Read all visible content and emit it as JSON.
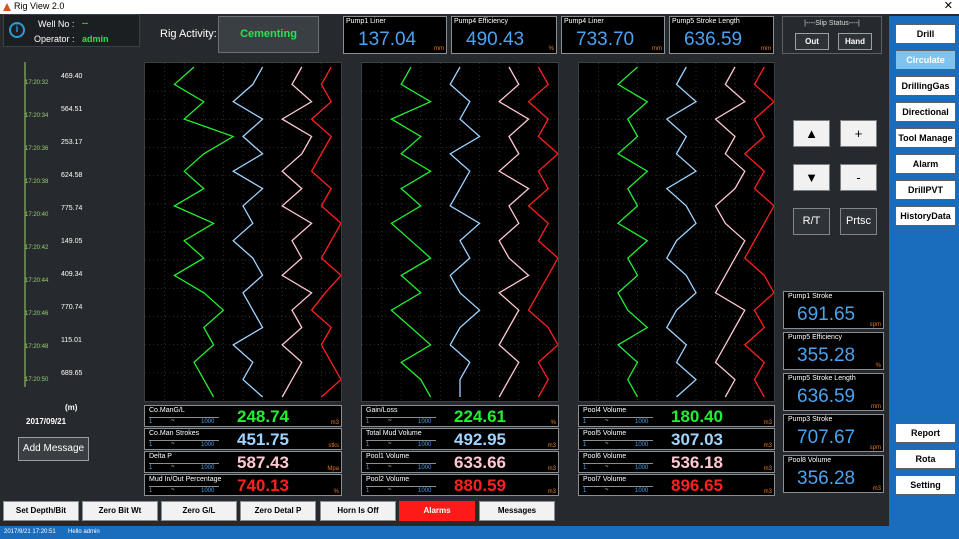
{
  "window": {
    "title": "Rig View 2.0",
    "close_glyph": "✕"
  },
  "user": {
    "well_label": "Well No :",
    "well_value": "--",
    "operator_label": "Operator :",
    "operator_value": "admin",
    "info_glyph": "i"
  },
  "rig_activity": {
    "label": "Rig Activity:",
    "value": "Cementing"
  },
  "top_pumps": [
    {
      "label": "Pump1 Liner",
      "value": "137.04",
      "unit": "mm"
    },
    {
      "label": "Pump4 Efficiency",
      "value": "490.43",
      "unit": "%"
    },
    {
      "label": "Pump4 Liner",
      "value": "733.70",
      "unit": "mm"
    },
    {
      "label": "Pump5 Stroke Length",
      "value": "636.59",
      "unit": "mm"
    }
  ],
  "slip": {
    "title": "|----Slip Status----|",
    "out": "Out",
    "hand": "Hand"
  },
  "nav": {
    "drill": "Drill",
    "circulate": "Circulate",
    "drillinggas": "DrillingGas",
    "directional": "Directional",
    "toolmanage": "Tool Manage",
    "alarm": "Alarm",
    "drillpvt": "DrillPVT",
    "historydata": "HistoryData",
    "report": "Report",
    "rota": "Rota",
    "setting": "Setting"
  },
  "controls": {
    "up": "▲",
    "plus": "+",
    "down": "▼",
    "minus": "-",
    "rt": "R/T",
    "prtsc": "Prtsc"
  },
  "right_panels": [
    {
      "label": "Pump1 Stroke",
      "value": "691.65",
      "unit": "spm"
    },
    {
      "label": "Pump5 Efficiency",
      "value": "355.28",
      "unit": "%"
    },
    {
      "label": "Pump5 Stroke Length",
      "value": "636.59",
      "unit": "mm"
    },
    {
      "label": "Pump3 Stroke",
      "value": "707.67",
      "unit": "spm"
    },
    {
      "label": "Pool8 Volume",
      "value": "356.28",
      "unit": "m3"
    }
  ],
  "depth": {
    "times": [
      "17:20:32",
      "17:20:34",
      "17:20:36",
      "17:20:38",
      "17:20:40",
      "17:20:42",
      "17:20:44",
      "17:20:46",
      "17:20:48",
      "17:20:50"
    ],
    "values": [
      "469.40",
      "564.51",
      "253.17",
      "624.58",
      "775.74",
      "149.05",
      "409.34",
      "770.74",
      "115.01",
      "689.65"
    ],
    "unit": "(m)",
    "date": "2017/09/21"
  },
  "add_message": "Add Message",
  "readouts": [
    [
      {
        "label": "Co.ManG/L",
        "min": "1",
        "max": "1000",
        "value": "248.74",
        "unit": "m3",
        "color": "#22ee33"
      },
      {
        "label": "Co.Man Strokes",
        "min": "1",
        "max": "1000",
        "value": "451.75",
        "unit": "stks",
        "color": "#9fd4ff"
      },
      {
        "label": "Delta P",
        "min": "1",
        "max": "1000",
        "value": "587.43",
        "unit": "Mpa",
        "color": "#ffc8d2"
      },
      {
        "label": "Mud In/Out Percentage",
        "min": "1",
        "max": "1000",
        "value": "740.13",
        "unit": "%",
        "color": "#ff2020"
      }
    ],
    [
      {
        "label": "Gain/Loss",
        "min": "1",
        "max": "1000",
        "value": "224.61",
        "unit": "%",
        "color": "#22ee33"
      },
      {
        "label": "Total Mud Volume",
        "min": "1",
        "max": "1000",
        "value": "492.95",
        "unit": "m3",
        "color": "#9fd4ff"
      },
      {
        "label": "Pool1 Volume",
        "min": "1",
        "max": "1000",
        "value": "633.66",
        "unit": "m3",
        "color": "#ffc8d2"
      },
      {
        "label": "Pool2 Volume",
        "min": "1",
        "max": "1000",
        "value": "880.59",
        "unit": "m3",
        "color": "#ff2020"
      }
    ],
    [
      {
        "label": "Pool4 Volume",
        "min": "1",
        "max": "1000",
        "value": "180.40",
        "unit": "m3",
        "color": "#22ee33"
      },
      {
        "label": "Pool5 Volume",
        "min": "1",
        "max": "1000",
        "value": "307.03",
        "unit": "m3",
        "color": "#9fd4ff"
      },
      {
        "label": "Pool6 Volume",
        "min": "1",
        "max": "1000",
        "value": "536.18",
        "unit": "m3",
        "color": "#ffc8d2"
      },
      {
        "label": "Pool7 Volume",
        "min": "1",
        "max": "1000",
        "value": "896.65",
        "unit": "m3",
        "color": "#ff2020"
      }
    ]
  ],
  "trends": [
    {
      "series": [
        [
          0.25,
          0.15,
          0.3,
          0.2,
          0.45,
          0.3,
          0.2,
          0.3,
          0.15,
          0.35,
          0.2,
          0.3,
          0.15,
          0.3,
          0.4,
          0.3,
          0.35,
          0.25,
          0.3,
          0.35
        ],
        [
          0.6,
          0.55,
          0.45,
          0.6,
          0.5,
          0.6,
          0.45,
          0.6,
          0.5,
          0.55,
          0.45,
          0.55,
          0.6,
          0.5,
          0.55,
          0.6,
          0.45,
          0.55,
          0.5,
          0.6
        ],
        [
          0.8,
          0.75,
          0.85,
          0.7,
          0.85,
          0.8,
          0.7,
          0.8,
          0.7,
          0.85,
          0.75,
          0.8,
          0.7,
          0.85,
          0.75,
          0.8,
          0.7,
          0.8,
          0.75,
          0.7
        ],
        [
          0.95,
          0.9,
          0.95,
          0.85,
          0.95,
          0.9,
          0.85,
          0.95,
          0.9,
          1.0,
          0.95,
          0.9,
          1.0,
          0.92,
          0.85,
          0.95,
          0.9,
          0.95,
          1.0,
          0.9
        ]
      ]
    },
    {
      "series": [
        [
          0.25,
          0.2,
          0.35,
          0.15,
          0.3,
          0.2,
          0.35,
          0.2,
          0.3,
          0.15,
          0.25,
          0.35,
          0.2,
          0.3,
          0.15,
          0.25,
          0.35,
          0.2,
          0.3,
          0.35
        ],
        [
          0.5,
          0.45,
          0.55,
          0.5,
          0.6,
          0.45,
          0.55,
          0.5,
          0.45,
          0.6,
          0.5,
          0.55,
          0.45,
          0.5,
          0.6,
          0.5,
          0.45,
          0.55,
          0.5,
          0.5
        ],
        [
          0.75,
          0.8,
          0.7,
          0.85,
          0.75,
          0.8,
          0.7,
          0.85,
          0.75,
          0.8,
          0.7,
          0.75,
          0.85,
          0.7,
          0.8,
          0.75,
          0.7,
          0.8,
          0.75,
          0.7
        ],
        [
          0.9,
          0.95,
          0.85,
          0.95,
          0.9,
          1.0,
          0.9,
          0.95,
          0.85,
          0.95,
          0.9,
          1.0,
          0.95,
          0.9,
          0.85,
          0.95,
          1.0,
          0.9,
          0.95,
          0.9
        ]
      ]
    },
    {
      "series": [
        [
          0.3,
          0.2,
          0.35,
          0.25,
          0.3,
          0.2,
          0.35,
          0.25,
          0.3,
          0.2,
          0.35,
          0.25,
          0.3,
          0.2,
          0.25,
          0.35,
          0.2,
          0.3,
          0.25,
          0.3
        ],
        [
          0.55,
          0.5,
          0.6,
          0.45,
          0.55,
          0.5,
          0.6,
          0.45,
          0.55,
          0.6,
          0.5,
          0.45,
          0.55,
          0.6,
          0.5,
          0.45,
          0.55,
          0.5,
          0.6,
          0.5
        ],
        [
          0.8,
          0.75,
          0.85,
          0.7,
          0.8,
          0.75,
          0.85,
          0.8,
          0.7,
          0.75,
          0.85,
          0.8,
          0.75,
          0.7,
          0.85,
          0.8,
          0.75,
          0.7,
          0.8,
          0.75
        ],
        [
          0.95,
          0.9,
          1.0,
          0.9,
          0.95,
          0.85,
          0.95,
          0.9,
          1.0,
          0.95,
          0.9,
          0.85,
          0.95,
          1.0,
          0.9,
          0.95,
          0.85,
          0.95,
          0.9,
          0.95
        ]
      ]
    }
  ],
  "bottom": {
    "set_depth": "Set Depth/Bit",
    "zero_bit": "Zero Bit Wt",
    "zero_gl": "Zero G/L",
    "zero_detal": "Zero Detal P",
    "horn": "Horn Is Off",
    "alarms": "Alarms",
    "messages": "Messages"
  },
  "status": {
    "datetime": "2017/9/21 17:20:51",
    "message": "Hello admin"
  }
}
